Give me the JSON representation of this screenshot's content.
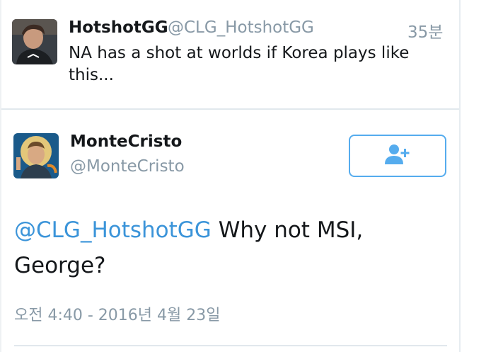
{
  "parent_tweet": {
    "name": "HotshotGG",
    "handle": "@CLG_HotshotGG",
    "time": "35분",
    "text": "NA has a shot at worlds if Korea plays like this..."
  },
  "main_tweet": {
    "name": "MonteCristo",
    "handle": "@MonteCristo",
    "follow_icon": "add-user-icon",
    "mention": "@CLG_HotshotGG",
    "text_rest": " Why not MSI, George?",
    "timestamp": "오전 4:40 - 2016년 4월 23일"
  },
  "colors": {
    "link": "#3b94d9",
    "accent": "#55acee",
    "muted": "#8899a6",
    "text": "#14171a"
  }
}
